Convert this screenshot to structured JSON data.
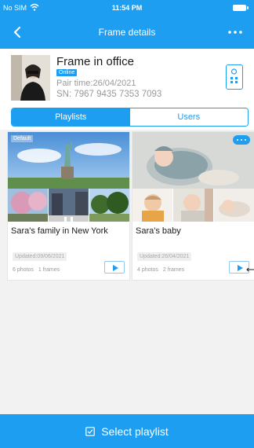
{
  "status_bar": {
    "carrier": "No SIM",
    "time": "11:54 PM"
  },
  "nav": {
    "title": "Frame details",
    "back_icon": "chevron-left-icon",
    "more_icon": "more-dots-icon"
  },
  "frame": {
    "name": "Frame in office",
    "status": "Online",
    "pair_time": "Pair time:26/04/2021",
    "serial": "SN: 7967 9435 7353 7093",
    "remote_icon": "remote-control-icon"
  },
  "tabs": [
    {
      "label": "Playlists",
      "active": true
    },
    {
      "label": "Users",
      "active": false
    }
  ],
  "playlists": [
    {
      "badge": "Default",
      "name": "Sara's family in New York",
      "updated": "Updated:09/06/2021",
      "photos": "6 photos",
      "frames": "1 frames"
    },
    {
      "name": "Sara's baby",
      "updated": "Updated:26/04/2021",
      "photos": "4 photos",
      "frames": "2 frames"
    }
  ],
  "bottom_action": {
    "label": "Select playlist",
    "icon": "checkbox-icon"
  },
  "colors": {
    "accent": "#1e9ef0",
    "background": "#f2f2f2"
  }
}
